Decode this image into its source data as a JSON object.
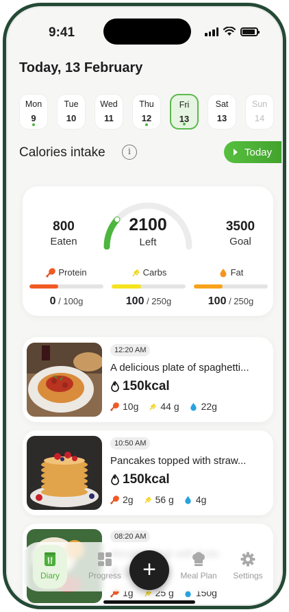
{
  "status": {
    "time": "9:41"
  },
  "header": {
    "title": "Today, 13 February"
  },
  "week": [
    {
      "name": "Mon",
      "num": "9",
      "dot": true
    },
    {
      "name": "Tue",
      "num": "10",
      "dot": false
    },
    {
      "name": "Wed",
      "num": "11",
      "dot": false
    },
    {
      "name": "Thu",
      "num": "12",
      "dot": true
    },
    {
      "name": "Fri",
      "num": "13",
      "dot": true,
      "active": true
    },
    {
      "name": "Sat",
      "num": "13",
      "dot": false
    },
    {
      "name": "Sun",
      "num": "14",
      "dot": false,
      "muted": true
    }
  ],
  "calories": {
    "section_title": "Calories intake",
    "info_icon": "i",
    "today_label": "Today",
    "eaten_value": "800",
    "eaten_label": "Eaten",
    "left_value": "2100",
    "left_label": "Left",
    "goal_value": "3500",
    "goal_label": "Goal",
    "gauge_fraction": 0.23,
    "accent": "#4cb63e"
  },
  "macros": [
    {
      "name": "Protein",
      "icon": "drumstick-icon",
      "value": "0",
      "unit": " / 100g",
      "fill": 0.39,
      "color": "#f15a24"
    },
    {
      "name": "Carbs",
      "icon": "wheat-icon",
      "value": "100",
      "unit": " / 250g",
      "fill": 0.4,
      "color": "#f5e31e"
    },
    {
      "name": "Fat",
      "icon": "fat-drop-icon",
      "value": "100",
      "unit": " / 250g",
      "fill": 0.39,
      "color": "#f7a31b"
    }
  ],
  "meals": [
    {
      "time": "12:20 AM",
      "title": "A delicious plate of spaghetti...",
      "kcal": "150kcal",
      "protein": "10g",
      "carbs": "44 g",
      "fat": "22g"
    },
    {
      "time": "10:50 AM",
      "title": "Pancakes topped with straw...",
      "kcal": "150kcal",
      "protein": "2g",
      "carbs": "56 g",
      "fat": "4g"
    },
    {
      "time": "08:20 AM",
      "title": "Wooden desk with fruits",
      "kcal": "150kcal",
      "protein": "1g",
      "carbs": "25 g",
      "fat": "150g"
    }
  ],
  "nav": {
    "items": [
      {
        "label": "Diary",
        "icon": "diary-icon",
        "active": true
      },
      {
        "label": "Progress",
        "icon": "progress-icon"
      },
      {
        "label": "Meal Plan",
        "icon": "chef-hat-icon"
      },
      {
        "label": "Settings",
        "icon": "gear-icon"
      }
    ],
    "add_label": "+"
  }
}
